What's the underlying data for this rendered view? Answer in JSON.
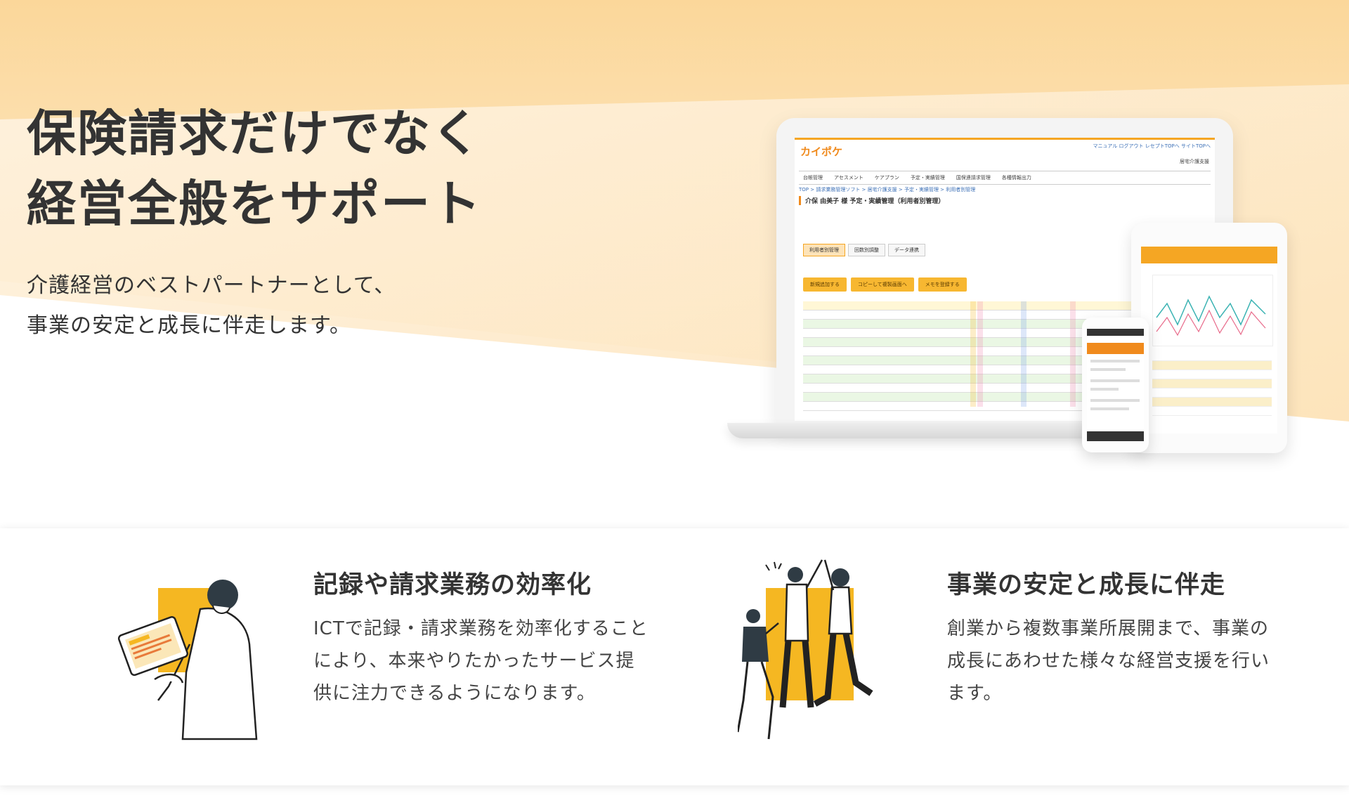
{
  "hero": {
    "title_line1": "保険請求だけでなく",
    "title_line2": "経営全般をサポート",
    "subtitle_line1": "介護経営のベストパートナーとして、",
    "subtitle_line2": "事業の安定と成長に伴走します。"
  },
  "mockup": {
    "logo": "カイポケ",
    "top_links": "マニュアル ログアウト レセプトTOPへ サイトTOPへ",
    "sub_label": "居宅介護支援",
    "nav_items": [
      "台帳管理",
      "アセスメント",
      "ケアプラン",
      "予定・実績管理",
      "国保連請求管理",
      "各種情報出力"
    ],
    "breadcrumb": "TOP > 請求業務管理ソフト > 居宅介護支援 > 予定・実績管理 > 利用者別管理",
    "page_title": "介保 由美子 様 予定・実績管理（利用者別管理）",
    "tabs": [
      "利用者別管理",
      "回数別調整",
      "データ連携"
    ],
    "buttons": [
      "新規追加する",
      "コピーして複製画面へ",
      "メモを登録する"
    ]
  },
  "features": [
    {
      "title": "記録や請求業務の効率化",
      "text_line1": "ICTで記録・請求業務を効率化すること",
      "text_line2": "により、本来やりたかったサービス提",
      "text_line3": "供に注力できるようになります。",
      "icon": "person-with-tablet-illustration"
    },
    {
      "title": "事業の安定と成長に伴走",
      "text_line1": "創業から複数事業所展開まで、事業の",
      "text_line2": "成長にあわせた様々な経営支援を行い",
      "text_line3": "ます。",
      "icon": "high-five-group-illustration"
    }
  ],
  "colors": {
    "accent": "#F5B722",
    "hero_gradient_top": "#FBD79A",
    "hero_gradient_light": "#FEF1DC",
    "text": "#333333"
  }
}
